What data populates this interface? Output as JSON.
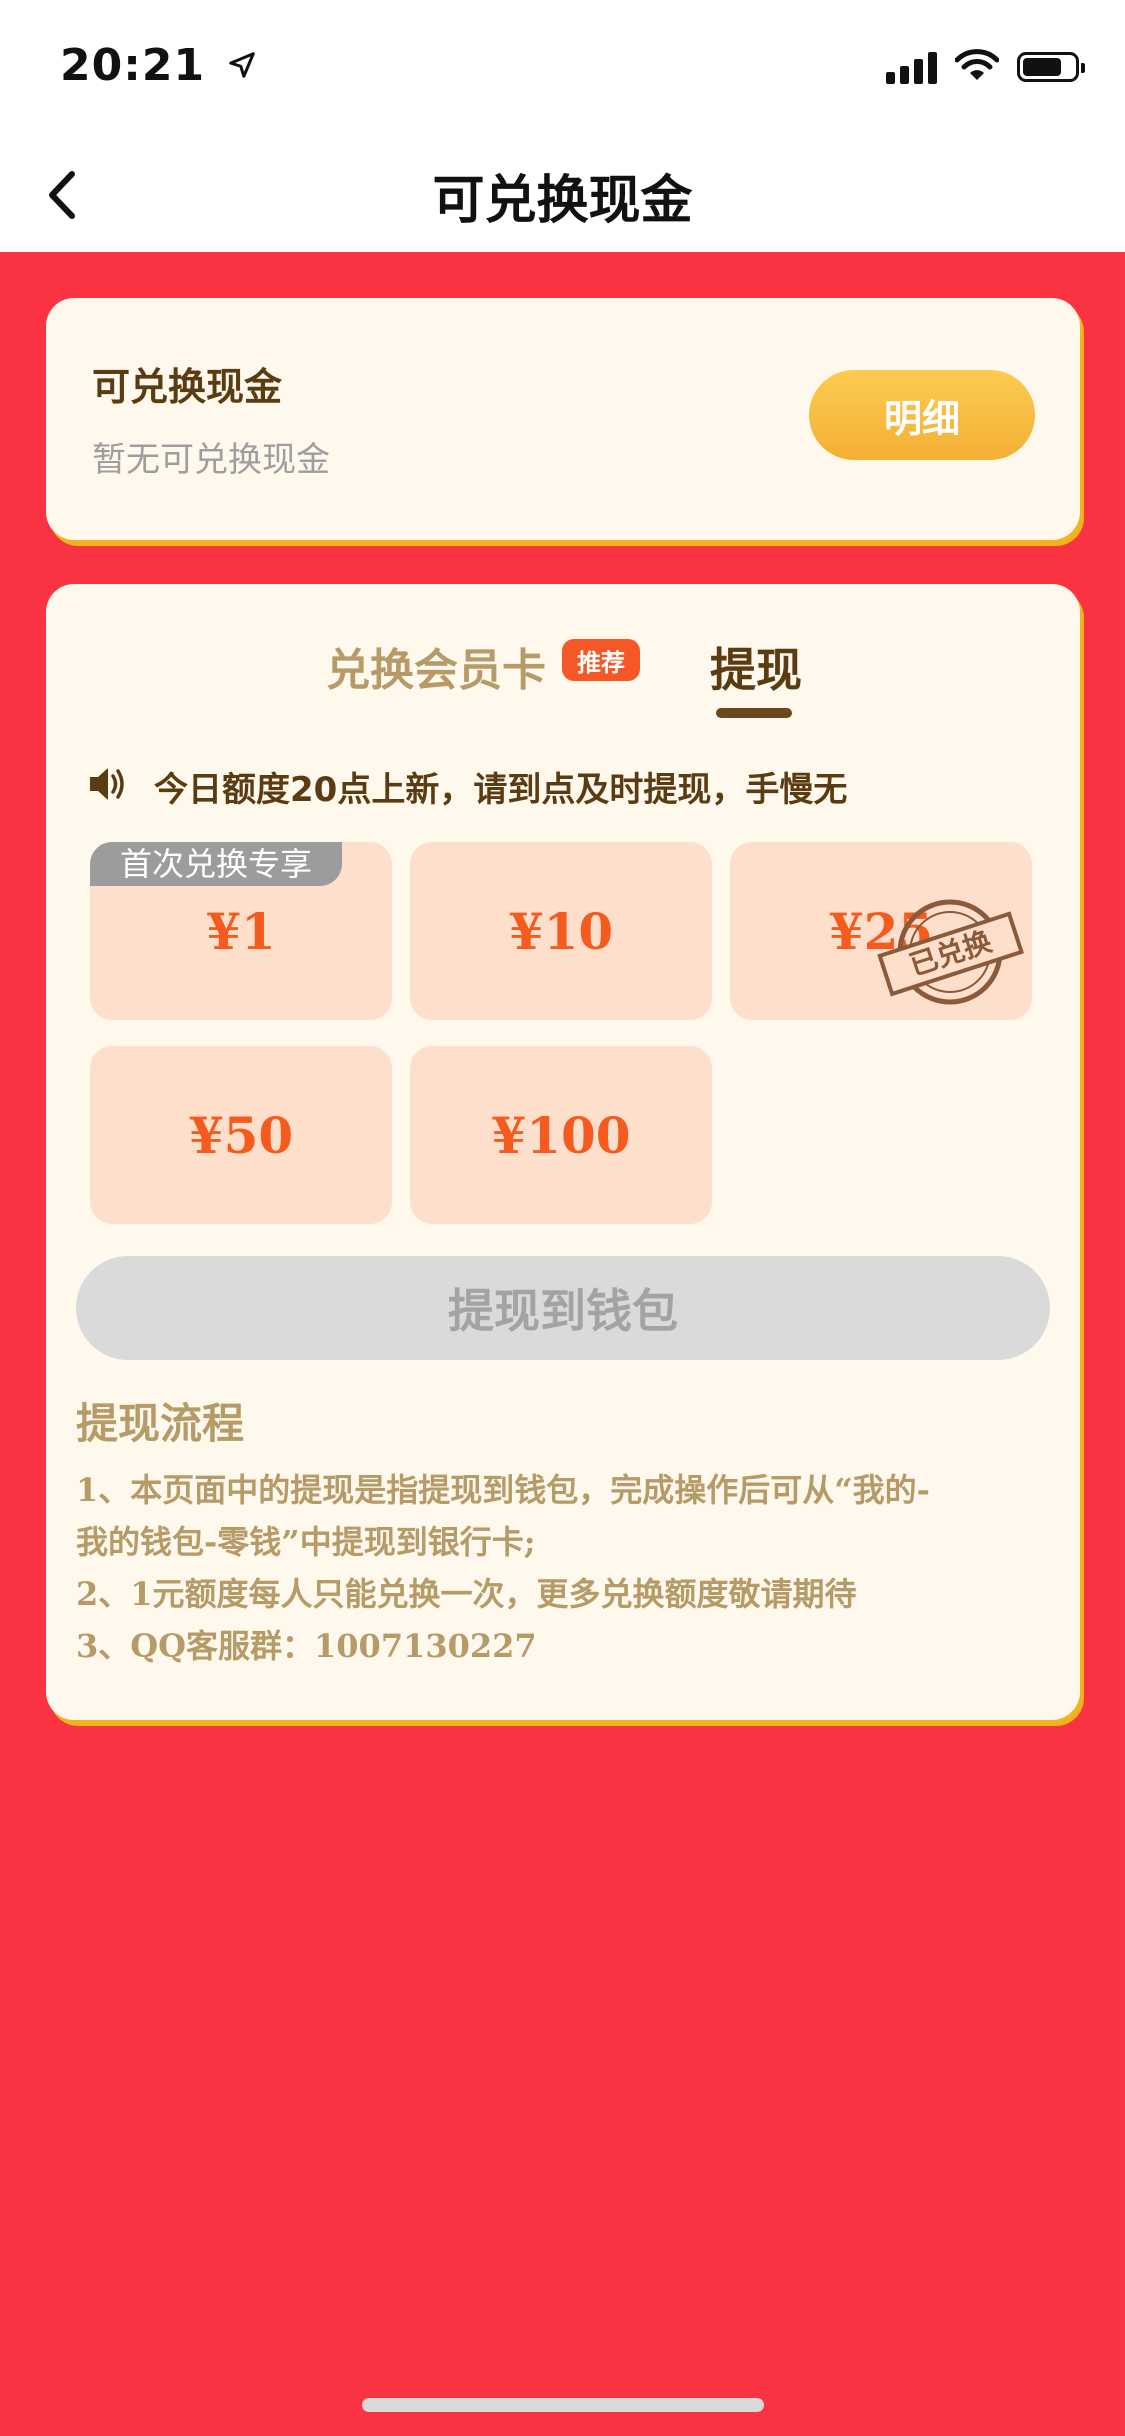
{
  "status_bar": {
    "time": "20:21"
  },
  "header": {
    "title": "可兑换现金"
  },
  "balance_card": {
    "title": "可兑换现金",
    "subtitle": "暂无可兑换现金",
    "detail_button": "明细"
  },
  "tabs": [
    {
      "label": "兑换会员卡",
      "badge": "推荐",
      "active": false
    },
    {
      "label": "提现",
      "active": true
    }
  ],
  "notice": "今日额度20点上新，请到点及时提现，手慢无",
  "amounts": [
    {
      "label": "¥1",
      "tag": "首次兑换专享"
    },
    {
      "label": "¥10"
    },
    {
      "label": "¥25",
      "stamp": "已兑换"
    },
    {
      "label": "¥50"
    },
    {
      "label": "¥100"
    }
  ],
  "withdraw_button": "提现到钱包",
  "flow": {
    "title": "提现流程",
    "lines": [
      "1、本页面中的提现是指提现到钱包，完成操作后可从“我的-",
      "我的钱包-零钱”中提现到银行卡;",
      "2、1元额度每人只能兑换一次，更多兑换额度敬请期待",
      "3、QQ客服群：1007130227"
    ]
  },
  "colors": {
    "background_red": "#F93341",
    "card_cream": "#FEF9EC",
    "brown_text": "#5A3B12",
    "gold_text": "#B69A67",
    "orange_amount": "#F55A1F",
    "amount_tile": "#FEDFCC",
    "button_gold": "#F3AF34"
  }
}
